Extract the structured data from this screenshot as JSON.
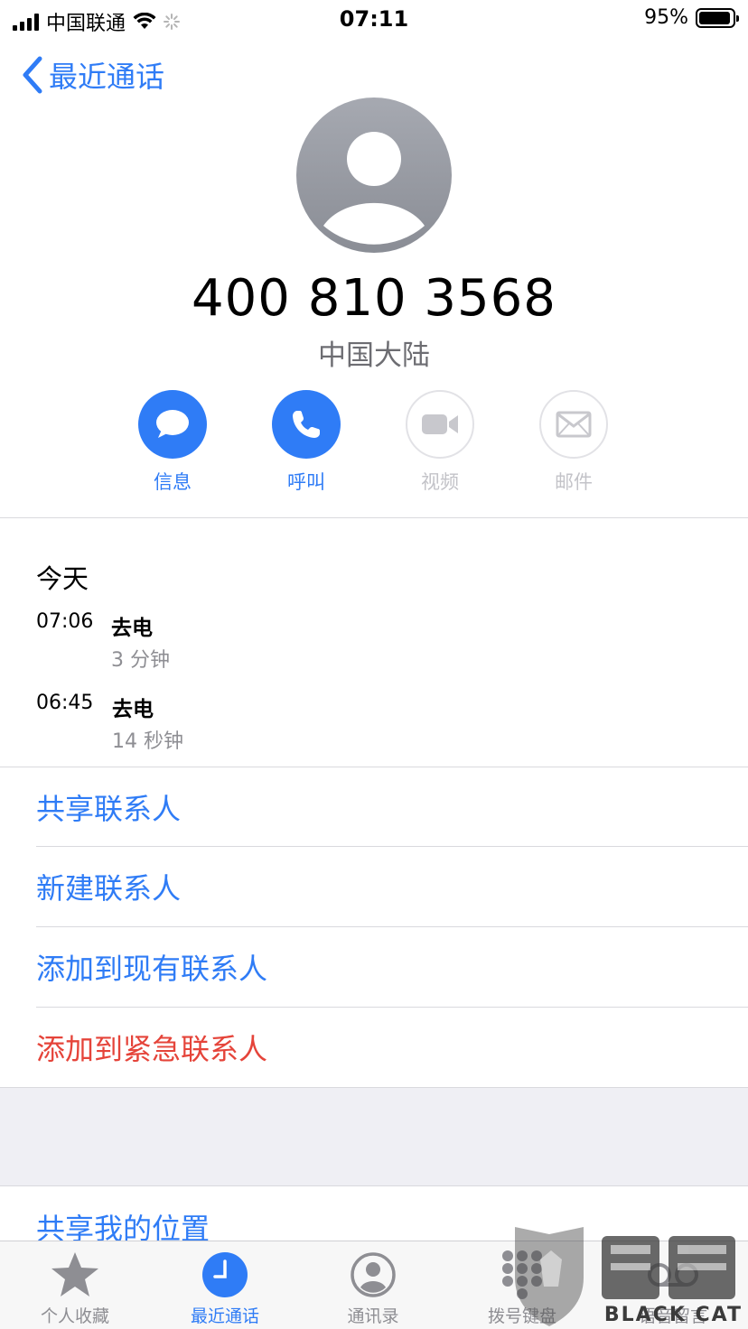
{
  "status_bar": {
    "carrier": "中国联通",
    "time": "07:11",
    "battery": "95%",
    "battery_level": 0.95
  },
  "nav": {
    "back_label": "最近通话"
  },
  "contact": {
    "number": "400 810 3568",
    "region": "中国大陆"
  },
  "actions": [
    {
      "label": "信息",
      "icon": "message-icon",
      "enabled": true
    },
    {
      "label": "呼叫",
      "icon": "phone-icon",
      "enabled": true
    },
    {
      "label": "视频",
      "icon": "video-icon",
      "enabled": false
    },
    {
      "label": "邮件",
      "icon": "mail-icon",
      "enabled": false
    }
  ],
  "history": {
    "title": "今天",
    "calls": [
      {
        "time": "07:06",
        "type": "去电",
        "duration": "3 分钟"
      },
      {
        "time": "06:45",
        "type": "去电",
        "duration": "14 秒钟"
      }
    ]
  },
  "menu": [
    {
      "label": "共享联系人"
    },
    {
      "label": "新建联系人"
    },
    {
      "label": "添加到现有联系人"
    },
    {
      "label": "添加到紧急联系人"
    }
  ],
  "share_location": "共享我的位置",
  "tabs": [
    {
      "label": "个人收藏",
      "icon": "star-icon"
    },
    {
      "label": "最近通话",
      "icon": "clock-icon",
      "active": true
    },
    {
      "label": "通讯录",
      "icon": "contacts-icon"
    },
    {
      "label": "拨号键盘",
      "icon": "keypad-icon"
    },
    {
      "label": "语音留言",
      "icon": "voicemail-icon"
    }
  ],
  "colors": {
    "accent": "#2f7cf6",
    "destructive": "#e5443a"
  },
  "watermark": "BLACK CAT"
}
